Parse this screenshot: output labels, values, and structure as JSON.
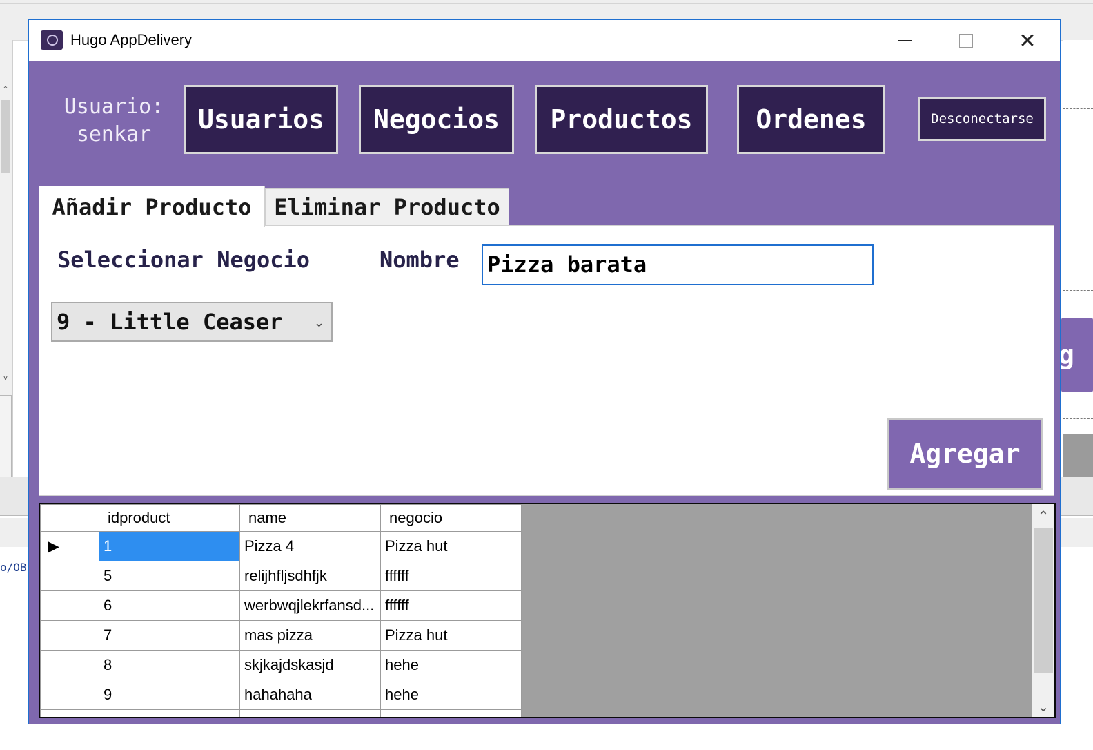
{
  "window": {
    "title": "Hugo AppDelivery",
    "accent_color": "#7f68ae",
    "nav_button_color": "#302050"
  },
  "header": {
    "user_label": "Usuario:",
    "user_name": "senkar",
    "nav": {
      "usuarios": "Usuarios",
      "negocios": "Negocios",
      "productos": "Productos",
      "ordenes": "Ordenes"
    },
    "logout": "Desconectarse"
  },
  "tabs": {
    "add": "Añadir Producto",
    "remove": "Eliminar Producto"
  },
  "form": {
    "negocio_label": "Seleccionar Negocio",
    "nombre_label": "Nombre",
    "nombre_value": "Pizza barata",
    "negocio_selected": "9 - Little Ceaser",
    "submit": "Agregar"
  },
  "grid": {
    "columns": [
      "idproduct",
      "name",
      "negocio"
    ],
    "rows": [
      [
        "1",
        "Pizza 4",
        "Pizza hut"
      ],
      [
        "5",
        "relijhfljsdhfjk",
        "ffffff"
      ],
      [
        "6",
        "werbwqjlekrfansd...",
        "ffffff"
      ],
      [
        "7",
        "mas pizza",
        "Pizza hut"
      ],
      [
        "8",
        "skjkajdskasjd",
        "hehe"
      ],
      [
        "9",
        "hahahaha",
        "hehe"
      ]
    ]
  },
  "background": {
    "code_snippet": "o/OB",
    "partial_button": "g"
  }
}
